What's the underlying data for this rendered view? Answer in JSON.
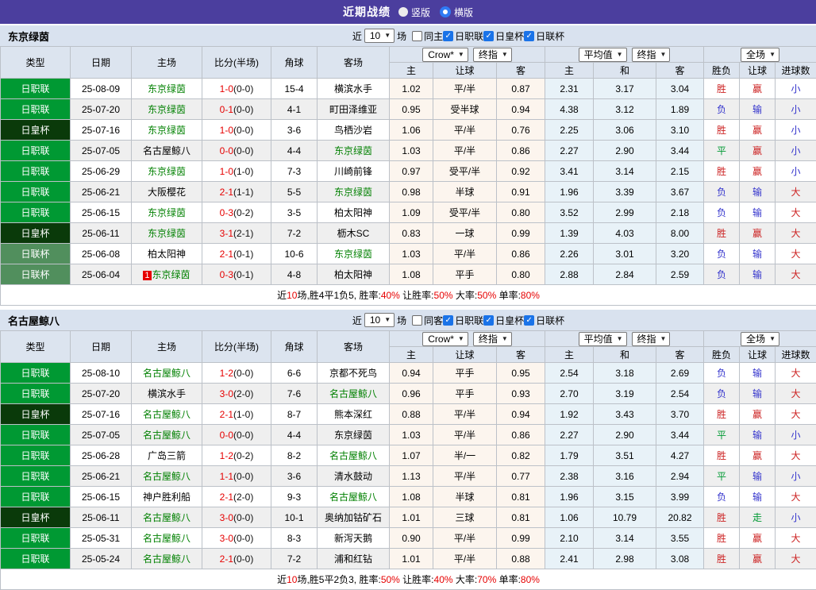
{
  "titlebar": {
    "title": "近期战绩",
    "radios": [
      {
        "label": "竖版",
        "selected": false
      },
      {
        "label": "横版",
        "selected": true
      }
    ]
  },
  "icons": {
    "check": "✓",
    "chevron_down": "▼"
  },
  "header_cols": [
    "类型",
    "日期",
    "主场",
    "比分(半场)",
    "角球",
    "客场"
  ],
  "odds_groups": [
    {
      "selects": [
        "Crow*",
        "终指"
      ],
      "cols": [
        "主",
        "让球",
        "客"
      ],
      "tint": "crow"
    },
    {
      "selects": [
        "平均值",
        "终指"
      ],
      "cols": [
        "主",
        "和",
        "客"
      ],
      "tint": "avg"
    },
    {
      "selects": [
        "全场"
      ],
      "cols": [
        "胜负",
        "让球",
        "进球数"
      ],
      "tint": ""
    }
  ],
  "league_colors": {
    "日职联": "#009933",
    "日皇杯": "#0a3a0a",
    "日联杯": "#518f5d"
  },
  "outcome_colors": {
    "胜": "#cc2222",
    "赢": "#cc2222",
    "大": "#cc2222",
    "平": "#009933",
    "走": "#009933",
    "负": "#3333cc",
    "输": "#3333cc",
    "小": "#3333cc"
  },
  "sections": [
    {
      "team": "东京绿茵",
      "filter": {
        "near_label": "近",
        "count": "10",
        "unit_label": "场",
        "same_label": "同主",
        "same_checked": false,
        "leagues": [
          "日职联",
          "日皇杯",
          "日联杯"
        ]
      },
      "rows": [
        {
          "league": "日职联",
          "date": "25-08-09",
          "home": "东京绿茵",
          "home_hl": true,
          "home_badge": "",
          "score": "1-0",
          "half": "(0-0)",
          "corners": "15-4",
          "away": "横滨水手",
          "away_hl": false,
          "odds1": [
            "1.02",
            "平/半",
            "0.87"
          ],
          "odds2": [
            "2.31",
            "3.17",
            "3.04"
          ],
          "outcome": [
            "胜",
            "赢",
            "小"
          ]
        },
        {
          "league": "日职联",
          "date": "25-07-20",
          "home": "东京绿茵",
          "home_hl": true,
          "home_badge": "",
          "score": "0-1",
          "half": "(0-0)",
          "corners": "4-1",
          "away": "町田泽维亚",
          "away_hl": false,
          "odds1": [
            "0.95",
            "受半球",
            "0.94"
          ],
          "odds2": [
            "4.38",
            "3.12",
            "1.89"
          ],
          "outcome": [
            "负",
            "输",
            "小"
          ]
        },
        {
          "league": "日皇杯",
          "date": "25-07-16",
          "home": "东京绿茵",
          "home_hl": true,
          "home_badge": "",
          "score": "1-0",
          "half": "(0-0)",
          "corners": "3-6",
          "away": "鸟栖沙岩",
          "away_hl": false,
          "odds1": [
            "1.06",
            "平/半",
            "0.76"
          ],
          "odds2": [
            "2.25",
            "3.06",
            "3.10"
          ],
          "outcome": [
            "胜",
            "赢",
            "小"
          ]
        },
        {
          "league": "日职联",
          "date": "25-07-05",
          "home": "名古屋鲸八",
          "home_hl": false,
          "home_badge": "",
          "score": "0-0",
          "half": "(0-0)",
          "corners": "4-4",
          "away": "东京绿茵",
          "away_hl": true,
          "odds1": [
            "1.03",
            "平/半",
            "0.86"
          ],
          "odds2": [
            "2.27",
            "2.90",
            "3.44"
          ],
          "outcome": [
            "平",
            "赢",
            "小"
          ]
        },
        {
          "league": "日职联",
          "date": "25-06-29",
          "home": "东京绿茵",
          "home_hl": true,
          "home_badge": "",
          "score": "1-0",
          "half": "(1-0)",
          "corners": "7-3",
          "away": "川崎前锋",
          "away_hl": false,
          "odds1": [
            "0.97",
            "受平/半",
            "0.92"
          ],
          "odds2": [
            "3.41",
            "3.14",
            "2.15"
          ],
          "outcome": [
            "胜",
            "赢",
            "小"
          ]
        },
        {
          "league": "日职联",
          "date": "25-06-21",
          "home": "大阪樱花",
          "home_hl": false,
          "home_badge": "",
          "score": "2-1",
          "half": "(1-1)",
          "corners": "5-5",
          "away": "东京绿茵",
          "away_hl": true,
          "odds1": [
            "0.98",
            "半球",
            "0.91"
          ],
          "odds2": [
            "1.96",
            "3.39",
            "3.67"
          ],
          "outcome": [
            "负",
            "输",
            "大"
          ]
        },
        {
          "league": "日职联",
          "date": "25-06-15",
          "home": "东京绿茵",
          "home_hl": true,
          "home_badge": "",
          "score": "0-3",
          "half": "(0-2)",
          "corners": "3-5",
          "away": "柏太阳神",
          "away_hl": false,
          "odds1": [
            "1.09",
            "受平/半",
            "0.80"
          ],
          "odds2": [
            "3.52",
            "2.99",
            "2.18"
          ],
          "outcome": [
            "负",
            "输",
            "大"
          ]
        },
        {
          "league": "日皇杯",
          "date": "25-06-11",
          "home": "东京绿茵",
          "home_hl": true,
          "home_badge": "",
          "score": "3-1",
          "half": "(2-1)",
          "corners": "7-2",
          "away": "枥木SC",
          "away_hl": false,
          "odds1": [
            "0.83",
            "一球",
            "0.99"
          ],
          "odds2": [
            "1.39",
            "4.03",
            "8.00"
          ],
          "outcome": [
            "胜",
            "赢",
            "大"
          ]
        },
        {
          "league": "日联杯",
          "date": "25-06-08",
          "home": "柏太阳神",
          "home_hl": false,
          "home_badge": "",
          "score": "2-1",
          "half": "(0-1)",
          "corners": "10-6",
          "away": "东京绿茵",
          "away_hl": true,
          "odds1": [
            "1.03",
            "平/半",
            "0.86"
          ],
          "odds2": [
            "2.26",
            "3.01",
            "3.20"
          ],
          "outcome": [
            "负",
            "输",
            "大"
          ]
        },
        {
          "league": "日联杯",
          "date": "25-06-04",
          "home": "东京绿茵",
          "home_hl": true,
          "home_badge": "1",
          "score": "0-3",
          "half": "(0-1)",
          "corners": "4-8",
          "away": "柏太阳神",
          "away_hl": false,
          "odds1": [
            "1.08",
            "平手",
            "0.80"
          ],
          "odds2": [
            "2.88",
            "2.84",
            "2.59"
          ],
          "outcome": [
            "负",
            "输",
            "大"
          ]
        }
      ],
      "summary": [
        {
          "t": "近",
          "c": "k"
        },
        {
          "t": "10",
          "c": "r"
        },
        {
          "t": "场,胜4平1负5, 胜率:",
          "c": "k"
        },
        {
          "t": "40%",
          "c": "r"
        },
        {
          "t": " 让胜率:",
          "c": "k"
        },
        {
          "t": "50%",
          "c": "r"
        },
        {
          "t": " 大率:",
          "c": "k"
        },
        {
          "t": "50%",
          "c": "r"
        },
        {
          "t": " 单率:",
          "c": "k"
        },
        {
          "t": "80%",
          "c": "r"
        }
      ]
    },
    {
      "team": "名古屋鲸八",
      "filter": {
        "near_label": "近",
        "count": "10",
        "unit_label": "场",
        "same_label": "同客",
        "same_checked": false,
        "leagues": [
          "日职联",
          "日皇杯",
          "日联杯"
        ]
      },
      "rows": [
        {
          "league": "日职联",
          "date": "25-08-10",
          "home": "名古屋鲸八",
          "home_hl": true,
          "home_badge": "",
          "score": "1-2",
          "half": "(0-0)",
          "corners": "6-6",
          "away": "京都不死鸟",
          "away_hl": false,
          "odds1": [
            "0.94",
            "平手",
            "0.95"
          ],
          "odds2": [
            "2.54",
            "3.18",
            "2.69"
          ],
          "outcome": [
            "负",
            "输",
            "大"
          ]
        },
        {
          "league": "日职联",
          "date": "25-07-20",
          "home": "横滨水手",
          "home_hl": false,
          "home_badge": "",
          "score": "3-0",
          "half": "(2-0)",
          "corners": "7-6",
          "away": "名古屋鲸八",
          "away_hl": true,
          "odds1": [
            "0.96",
            "平手",
            "0.93"
          ],
          "odds2": [
            "2.70",
            "3.19",
            "2.54"
          ],
          "outcome": [
            "负",
            "输",
            "大"
          ]
        },
        {
          "league": "日皇杯",
          "date": "25-07-16",
          "home": "名古屋鲸八",
          "home_hl": true,
          "home_badge": "",
          "score": "2-1",
          "half": "(1-0)",
          "corners": "8-7",
          "away": "熊本深红",
          "away_hl": false,
          "odds1": [
            "0.88",
            "平/半",
            "0.94"
          ],
          "odds2": [
            "1.92",
            "3.43",
            "3.70"
          ],
          "outcome": [
            "胜",
            "赢",
            "大"
          ]
        },
        {
          "league": "日职联",
          "date": "25-07-05",
          "home": "名古屋鲸八",
          "home_hl": true,
          "home_badge": "",
          "score": "0-0",
          "half": "(0-0)",
          "corners": "4-4",
          "away": "东京绿茵",
          "away_hl": false,
          "odds1": [
            "1.03",
            "平/半",
            "0.86"
          ],
          "odds2": [
            "2.27",
            "2.90",
            "3.44"
          ],
          "outcome": [
            "平",
            "输",
            "小"
          ]
        },
        {
          "league": "日职联",
          "date": "25-06-28",
          "home": "广岛三箭",
          "home_hl": false,
          "home_badge": "",
          "score": "1-2",
          "half": "(0-2)",
          "corners": "8-2",
          "away": "名古屋鲸八",
          "away_hl": true,
          "odds1": [
            "1.07",
            "半/一",
            "0.82"
          ],
          "odds2": [
            "1.79",
            "3.51",
            "4.27"
          ],
          "outcome": [
            "胜",
            "赢",
            "大"
          ]
        },
        {
          "league": "日职联",
          "date": "25-06-21",
          "home": "名古屋鲸八",
          "home_hl": true,
          "home_badge": "",
          "score": "1-1",
          "half": "(0-0)",
          "corners": "3-6",
          "away": "清水鼓动",
          "away_hl": false,
          "odds1": [
            "1.13",
            "平/半",
            "0.77"
          ],
          "odds2": [
            "2.38",
            "3.16",
            "2.94"
          ],
          "outcome": [
            "平",
            "输",
            "小"
          ]
        },
        {
          "league": "日职联",
          "date": "25-06-15",
          "home": "神户胜利船",
          "home_hl": false,
          "home_badge": "",
          "score": "2-1",
          "half": "(2-0)",
          "corners": "9-3",
          "away": "名古屋鲸八",
          "away_hl": true,
          "odds1": [
            "1.08",
            "半球",
            "0.81"
          ],
          "odds2": [
            "1.96",
            "3.15",
            "3.99"
          ],
          "outcome": [
            "负",
            "输",
            "大"
          ]
        },
        {
          "league": "日皇杯",
          "date": "25-06-11",
          "home": "名古屋鲸八",
          "home_hl": true,
          "home_badge": "",
          "score": "3-0",
          "half": "(0-0)",
          "corners": "10-1",
          "away": "奥纳加钴矿石",
          "away_hl": false,
          "odds1": [
            "1.01",
            "三球",
            "0.81"
          ],
          "odds2": [
            "1.06",
            "10.79",
            "20.82"
          ],
          "outcome": [
            "胜",
            "走",
            "小"
          ]
        },
        {
          "league": "日职联",
          "date": "25-05-31",
          "home": "名古屋鲸八",
          "home_hl": true,
          "home_badge": "",
          "score": "3-0",
          "half": "(0-0)",
          "corners": "8-3",
          "away": "新泻天鹅",
          "away_hl": false,
          "odds1": [
            "0.90",
            "平/半",
            "0.99"
          ],
          "odds2": [
            "2.10",
            "3.14",
            "3.55"
          ],
          "outcome": [
            "胜",
            "赢",
            "大"
          ]
        },
        {
          "league": "日职联",
          "date": "25-05-24",
          "home": "名古屋鲸八",
          "home_hl": true,
          "home_badge": "",
          "score": "2-1",
          "half": "(0-0)",
          "corners": "7-2",
          "away": "浦和红钻",
          "away_hl": false,
          "odds1": [
            "1.01",
            "平/半",
            "0.88"
          ],
          "odds2": [
            "2.41",
            "2.98",
            "3.08"
          ],
          "outcome": [
            "胜",
            "赢",
            "大"
          ]
        }
      ],
      "summary": [
        {
          "t": "近",
          "c": "k"
        },
        {
          "t": "10",
          "c": "r"
        },
        {
          "t": "场,胜5平2负3, 胜率:",
          "c": "k"
        },
        {
          "t": "50%",
          "c": "r"
        },
        {
          "t": " 让胜率:",
          "c": "k"
        },
        {
          "t": "40%",
          "c": "r"
        },
        {
          "t": " 大率:",
          "c": "k"
        },
        {
          "t": "70%",
          "c": "r"
        },
        {
          "t": " 单率:",
          "c": "k"
        },
        {
          "t": "80%",
          "c": "r"
        }
      ]
    }
  ]
}
